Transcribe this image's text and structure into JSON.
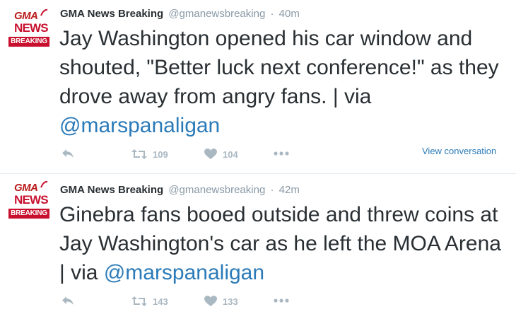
{
  "tweets": [
    {
      "author_name": "GMA News Breaking",
      "handle": "@gmanewsbreaking",
      "separator": "·",
      "time": "40m",
      "logo": {
        "gma": "GMA",
        "news": "NEWS",
        "breaking": "BREAKING"
      },
      "text_before": "Jay Washington opened his car window and shouted, \"Better luck next conference!\" as they drove away from angry fans. | via ",
      "mention": "@marspanaligan",
      "retweet_count": "109",
      "like_count": "104",
      "view_conversation": "View conversation"
    },
    {
      "author_name": "GMA News Breaking",
      "handle": "@gmanewsbreaking",
      "separator": "·",
      "time": "42m",
      "logo": {
        "gma": "GMA",
        "news": "NEWS",
        "breaking": "BREAKING"
      },
      "text_before": "Ginebra fans booed outside and threw coins at Jay Washington's car as he left the MOA Arena | via ",
      "mention": "@marspanaligan",
      "retweet_count": "143",
      "like_count": "133"
    }
  ],
  "icons": {
    "reply": "reply-icon",
    "retweet": "retweet-icon",
    "like": "heart-icon",
    "more": "more-dots-icon"
  },
  "colors": {
    "text": "#292f33",
    "meta": "#8899a6",
    "link": "#2b7bb9",
    "icon": "#aab8c2",
    "brand_red": "#c8102e",
    "divider": "#e1e8ed"
  }
}
